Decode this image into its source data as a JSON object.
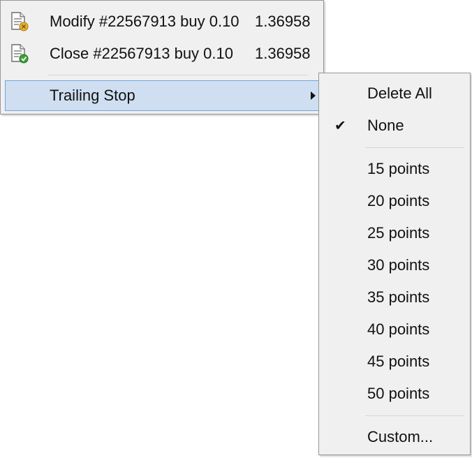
{
  "main_menu": {
    "items": [
      {
        "label": "Modify #22567913 buy 0.10",
        "price": "1.36958",
        "icon": "modify-order-icon"
      },
      {
        "label": "Close #22567913 buy 0.10",
        "price": "1.36958",
        "icon": "close-order-icon"
      }
    ],
    "submenu_label": "Trailing Stop"
  },
  "trailing_stop_menu": {
    "items": [
      {
        "label": "Delete All",
        "checked": false
      },
      {
        "label": "None",
        "checked": true
      },
      {
        "label": "15 points",
        "checked": false
      },
      {
        "label": "20 points",
        "checked": false
      },
      {
        "label": "25 points",
        "checked": false
      },
      {
        "label": "30 points",
        "checked": false
      },
      {
        "label": "35 points",
        "checked": false
      },
      {
        "label": "40 points",
        "checked": false
      },
      {
        "label": "45 points",
        "checked": false
      },
      {
        "label": "50 points",
        "checked": false
      },
      {
        "label": "Custom...",
        "checked": false
      }
    ],
    "check_glyph": "✔"
  },
  "colors": {
    "menu_bg": "#f0f0f0",
    "border": "#979797",
    "highlight_bg": "#cfdff1",
    "highlight_border": "#70a4dc",
    "badge_warn": "#e8b530",
    "badge_ok": "#3aa23a"
  }
}
